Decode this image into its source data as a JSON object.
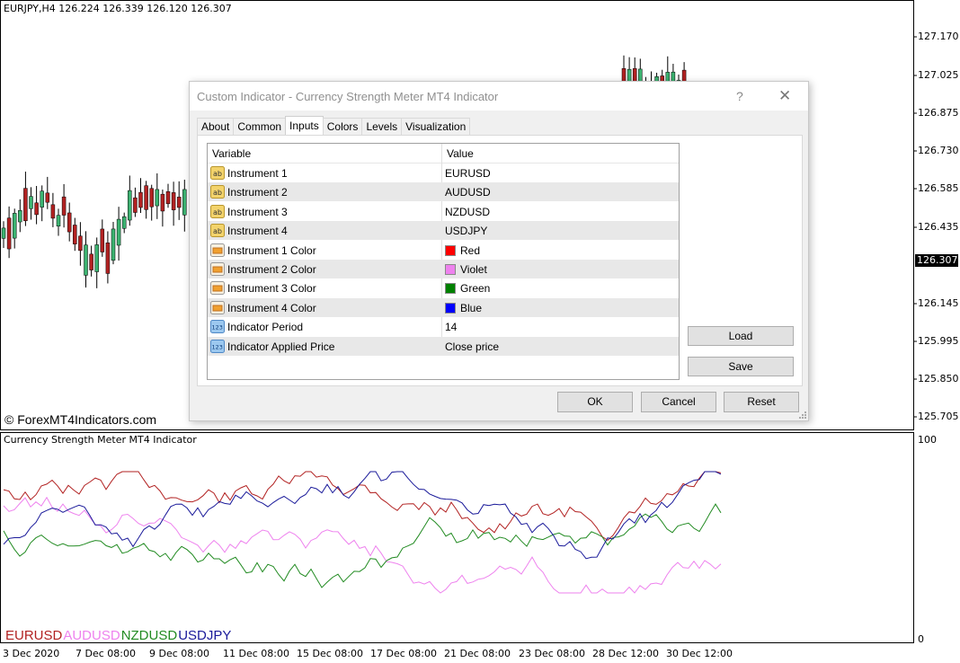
{
  "chart": {
    "symbol_header": "EURJPY,H4  126.224 126.339 126.120 126.307",
    "current_price": "126.307",
    "price_labels": [
      "127.170",
      "127.025",
      "126.875",
      "126.730",
      "126.585",
      "126.435",
      "126.145",
      "125.995",
      "125.850",
      "125.705"
    ],
    "watermark": "© ForexMT4Indicators.com",
    "indicator_title": "Currency Strength Meter MT4 Indicator",
    "indicator_scale_top": "100",
    "indicator_scale_bottom": "0",
    "time_labels": [
      "3 Dec 2020",
      "7 Dec 08:00",
      "9 Dec 08:00",
      "11 Dec 08:00",
      "15 Dec 08:00",
      "17 Dec 08:00",
      "21 Dec 08:00",
      "23 Dec 08:00",
      "28 Dec 12:00",
      "30 Dec 12:00"
    ],
    "legend": [
      {
        "label": "EURUSD",
        "color": "#b22222"
      },
      {
        "label": "AUDUSD",
        "color": "#ee82ee"
      },
      {
        "label": "NZDUSD",
        "color": "#228b22"
      },
      {
        "label": "USDJPY",
        "color": "#1a1a9a"
      }
    ],
    "colors": {
      "bull": "#3cb371",
      "bear": "#b22222",
      "wick": "#000000"
    }
  },
  "dialog": {
    "title": "Custom Indicator - Currency Strength Meter MT4 Indicator",
    "help": "?",
    "close": "✕",
    "tabs": [
      "About",
      "Common",
      "Inputs",
      "Colors",
      "Levels",
      "Visualization"
    ],
    "active_tab": "Inputs",
    "columns": {
      "variable": "Variable",
      "value": "Value"
    },
    "rows": [
      {
        "icon": "ab",
        "variable": "Instrument 1",
        "value": "EURUSD"
      },
      {
        "icon": "ab",
        "variable": "Instrument 2",
        "value": "AUDUSD"
      },
      {
        "icon": "ab",
        "variable": "Instrument 3",
        "value": "NZDUSD"
      },
      {
        "icon": "ab",
        "variable": "Instrument 4",
        "value": "USDJPY"
      },
      {
        "icon": "color",
        "variable": "Instrument 1 Color",
        "value": "Red",
        "swatch": "#ff0000"
      },
      {
        "icon": "color",
        "variable": "Instrument 2 Color",
        "value": "Violet",
        "swatch": "#ee82ee"
      },
      {
        "icon": "color",
        "variable": "Instrument 3 Color",
        "value": "Green",
        "swatch": "#008000"
      },
      {
        "icon": "color",
        "variable": "Instrument 4 Color",
        "value": "Blue",
        "swatch": "#0000ff"
      },
      {
        "icon": "123",
        "variable": "Indicator Period",
        "value": "14"
      },
      {
        "icon": "123",
        "variable": "Indicator Applied Price",
        "value": "Close price"
      }
    ],
    "buttons": {
      "load": "Load",
      "save": "Save",
      "ok": "OK",
      "cancel": "Cancel",
      "reset": "Reset"
    }
  }
}
